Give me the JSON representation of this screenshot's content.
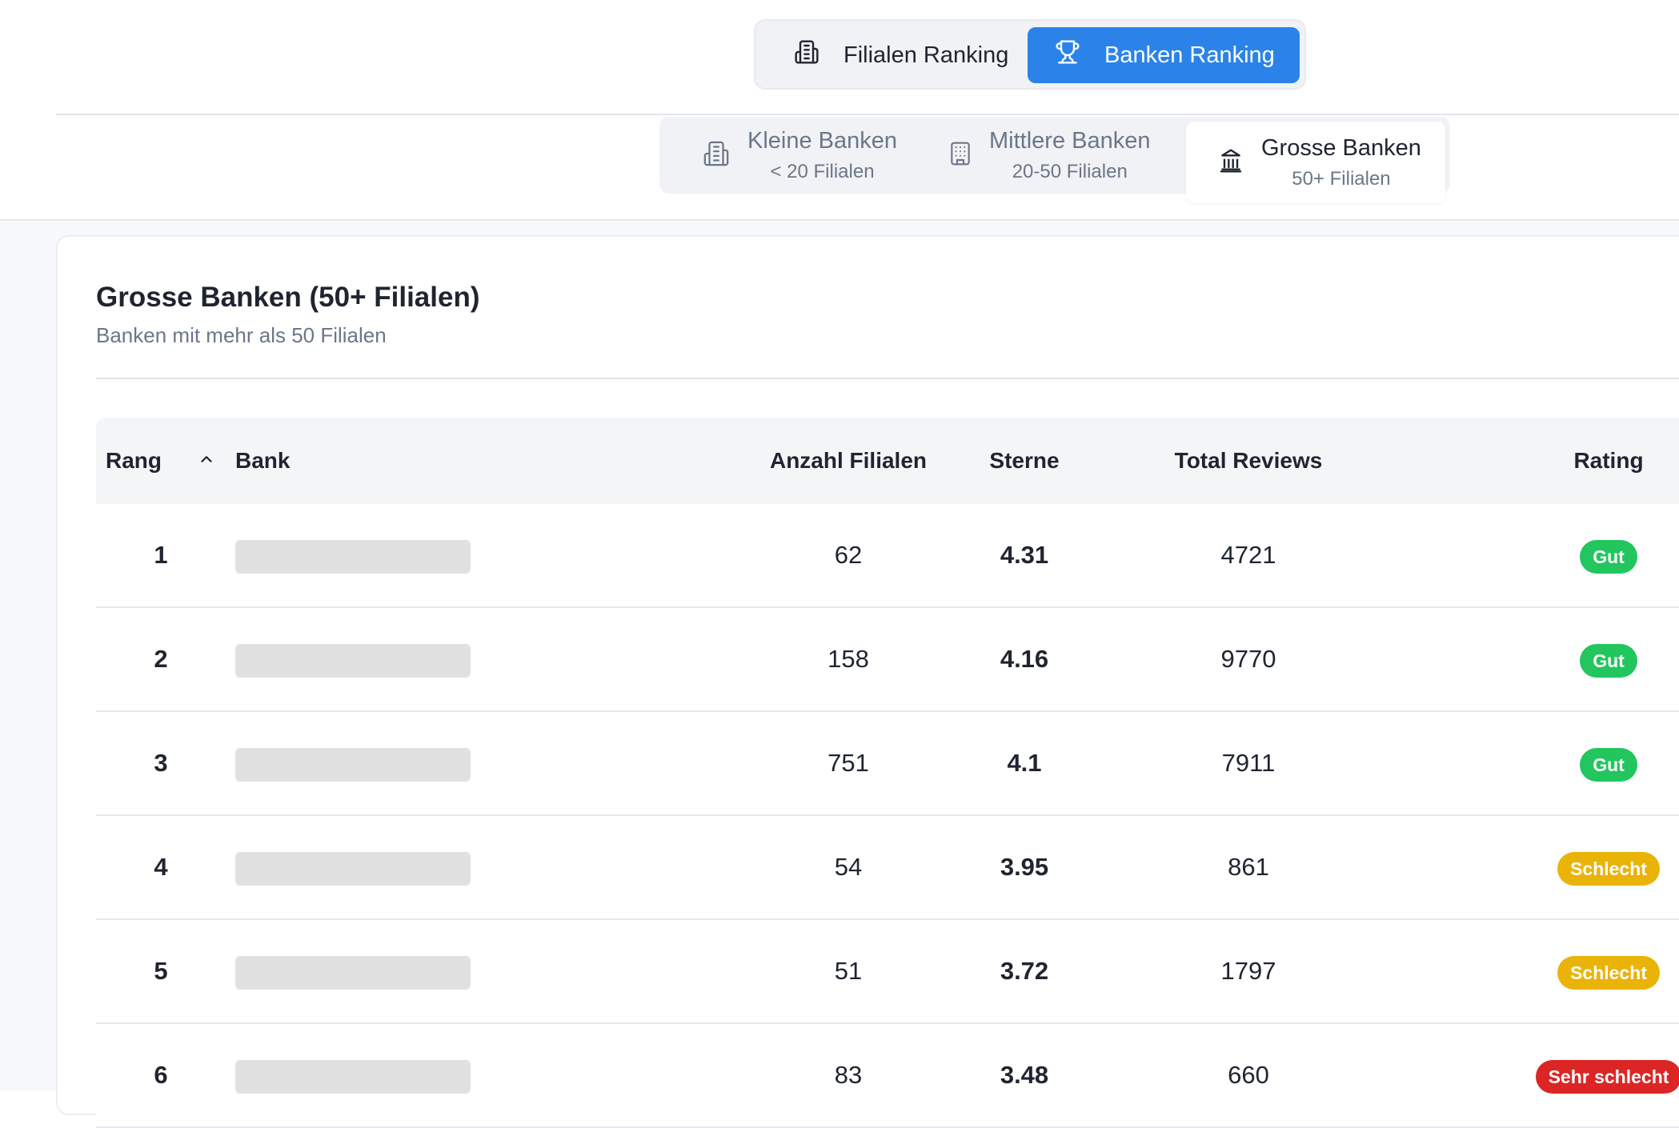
{
  "main_toggle": {
    "filialen_label": "Filialen Ranking",
    "banken_label": "Banken Ranking",
    "filialen_icon": "building-icon",
    "banken_icon": "trophy-icon",
    "active": "Banken Ranking",
    "accent_color": "#2b83ea"
  },
  "sub_tabs": [
    {
      "label": "Kleine Banken",
      "sub": "< 20 Filialen",
      "icon": "building-icon"
    },
    {
      "label": "Mittlere Banken",
      "sub": "20-50 Filialen",
      "icon": "office-building-icon"
    },
    {
      "label": "Grosse Banken",
      "sub": "50+ Filialen",
      "icon": "bank-icon",
      "active": true
    }
  ],
  "card": {
    "title": "Grosse Banken (50+ Filialen)",
    "subtitle": "Banken mit mehr als 50 Filialen"
  },
  "table": {
    "headers": {
      "rank": "Rang",
      "bank": "Bank",
      "filialen": "Anzahl Filialen",
      "sterne": "Sterne",
      "reviews": "Total Reviews",
      "rating": "Rating"
    },
    "sort_icon": "chevron-up-icon",
    "rows": [
      {
        "rank": "1",
        "filialen": "62",
        "sterne": "4.31",
        "reviews": "4721",
        "rating": "Gut",
        "rating_color": "#22c55e"
      },
      {
        "rank": "2",
        "filialen": "158",
        "sterne": "4.16",
        "reviews": "9770",
        "rating": "Gut",
        "rating_color": "#22c55e"
      },
      {
        "rank": "3",
        "filialen": "751",
        "sterne": "4.1",
        "reviews": "7911",
        "rating": "Gut",
        "rating_color": "#22c55e"
      },
      {
        "rank": "4",
        "filialen": "54",
        "sterne": "3.95",
        "reviews": "861",
        "rating": "Schlecht",
        "rating_color": "#eab308"
      },
      {
        "rank": "5",
        "filialen": "51",
        "sterne": "3.72",
        "reviews": "1797",
        "rating": "Schlecht",
        "rating_color": "#eab308"
      },
      {
        "rank": "6",
        "filialen": "83",
        "sterne": "3.48",
        "reviews": "660",
        "rating": "Sehr schlecht",
        "rating_color": "#dc2626"
      }
    ]
  }
}
